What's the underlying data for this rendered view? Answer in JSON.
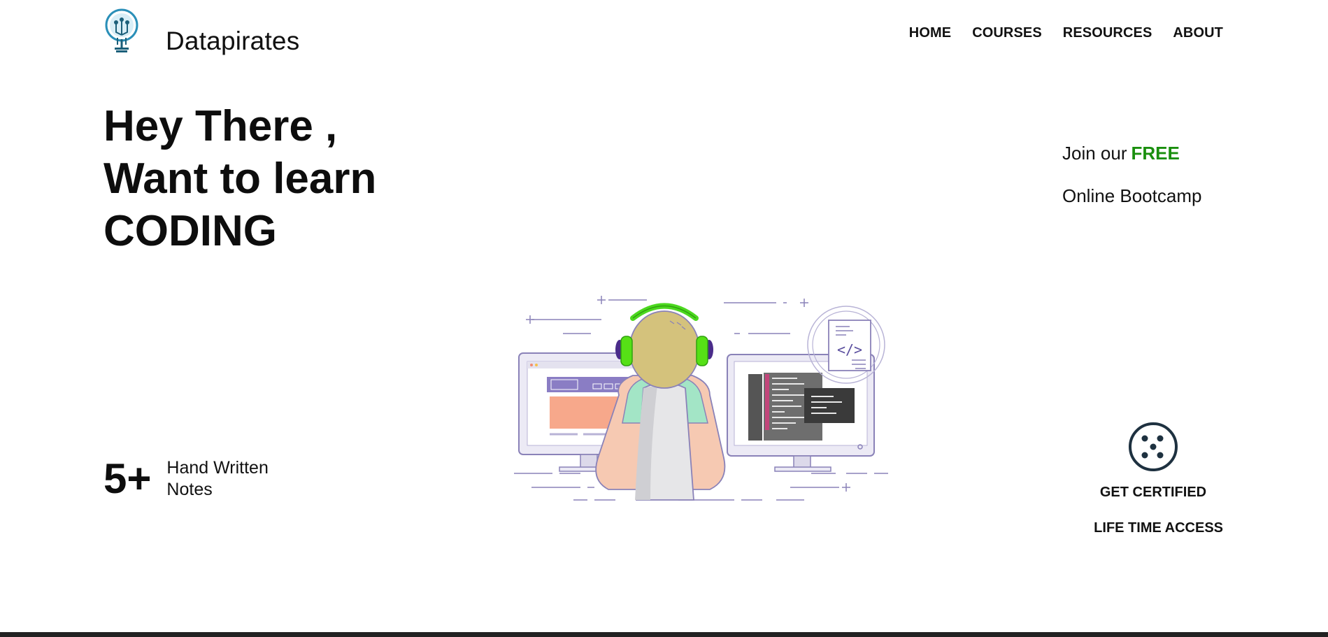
{
  "brand": {
    "name": "Datapirates",
    "logo_icon": "lightbulb-circuit-icon",
    "logo_color": "#2a8fb8"
  },
  "nav": {
    "items": [
      {
        "label": "HOME"
      },
      {
        "label": "COURSES"
      },
      {
        "label": "RESOURCES"
      },
      {
        "label": "ABOUT"
      }
    ]
  },
  "hero": {
    "line1": "Hey There ,",
    "line2": "Want to learn",
    "line3": "CODING"
  },
  "promo": {
    "prefix": "Join our",
    "highlight": "FREE",
    "highlight_color": "#1a8f0e",
    "line2": "Online Bootcamp"
  },
  "stat": {
    "value": "5+",
    "label_line1": "Hand Written",
    "label_line2": "Notes"
  },
  "certification": {
    "icon": "dice-five-icon",
    "title": "GET CERTIFIED",
    "subtitle": "LIFE TIME ACCESS"
  },
  "illustration": {
    "name": "developer-at-dual-monitors",
    "code_badge": "</>"
  }
}
